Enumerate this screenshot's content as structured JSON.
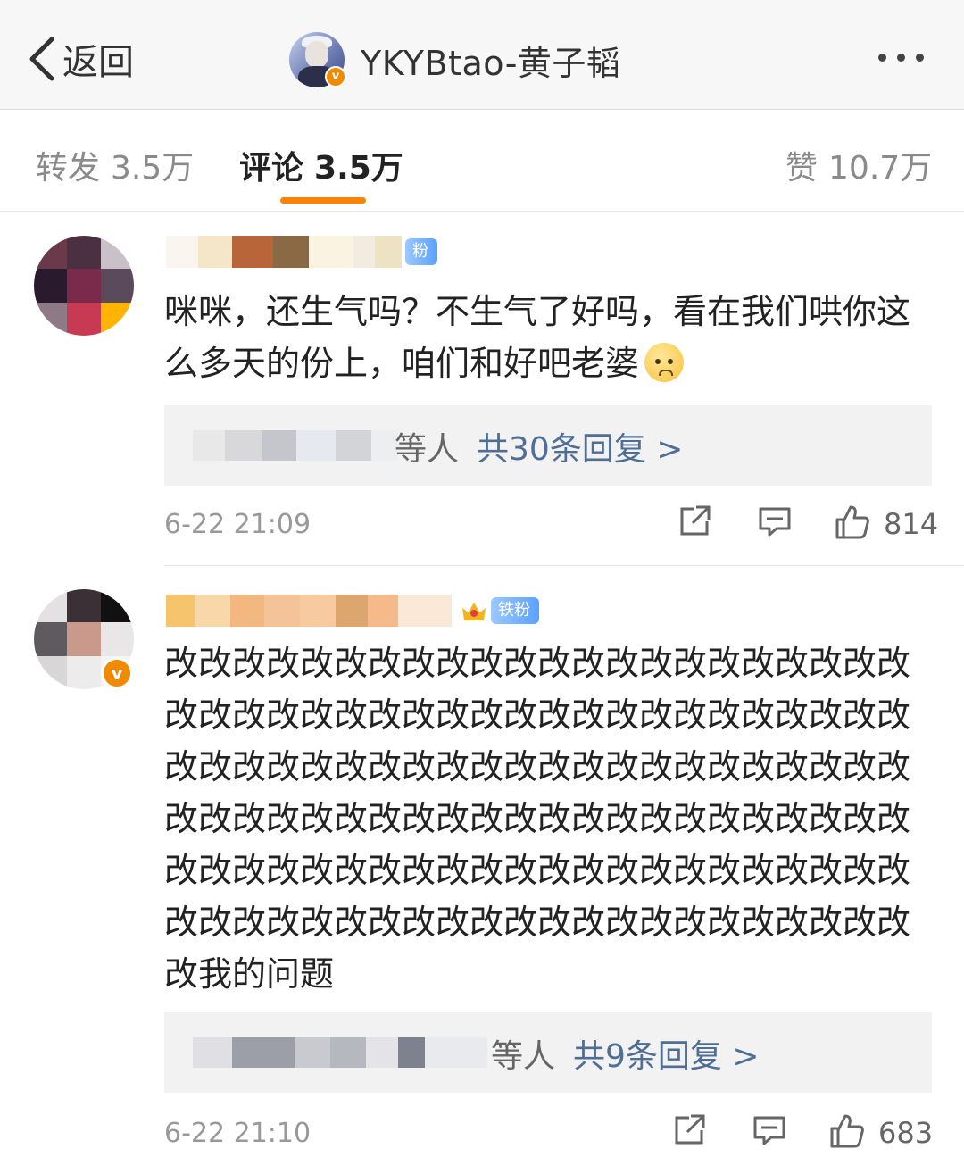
{
  "nav": {
    "back_label": "返回",
    "profile_name": "YKYBtao-黄子韬",
    "verified_mark": "v"
  },
  "tabs": [
    {
      "label": "转发",
      "count": "3.5万",
      "active": false
    },
    {
      "label": "评论",
      "count": "3.5万",
      "active": true
    },
    {
      "label": "赞",
      "count": "10.7万",
      "active": false
    }
  ],
  "colors": {
    "accent": "#ff8200",
    "link": "#4e6e95",
    "verified": "#f08a00"
  },
  "comments": [
    {
      "fan_badge": "粉",
      "text": "咪咪，还生气吗？不生气了好吗，看在我们哄你这么多天的份上，咱们和好吧老婆",
      "emoji": "pleading-face",
      "reply_suffix": "等人",
      "reply_link": "共30条回复 >",
      "time": "6-22 21:09",
      "likes": "814"
    },
    {
      "fan_badge": "铁粉",
      "text": "改改改改改改改改改改改改改改改改改改改改改改改改改改改改改改改改改改改改改改改改改改改改改改改改改改改改改改改改改改改改改改改改改改改改改改改改改改改改改改改改改改改改改改改改改改改改改改改改改改改改改改改改改改改改改改改改改改改改改改改改改改改改改改改改改改改改改我的问题",
      "reply_suffix": "等人",
      "reply_link": "共9条回复 >",
      "time": "6-22 21:10",
      "likes": "683"
    }
  ],
  "icons": [
    "chevron-left-icon",
    "more-icon",
    "share-icon",
    "comment-icon",
    "like-icon"
  ]
}
